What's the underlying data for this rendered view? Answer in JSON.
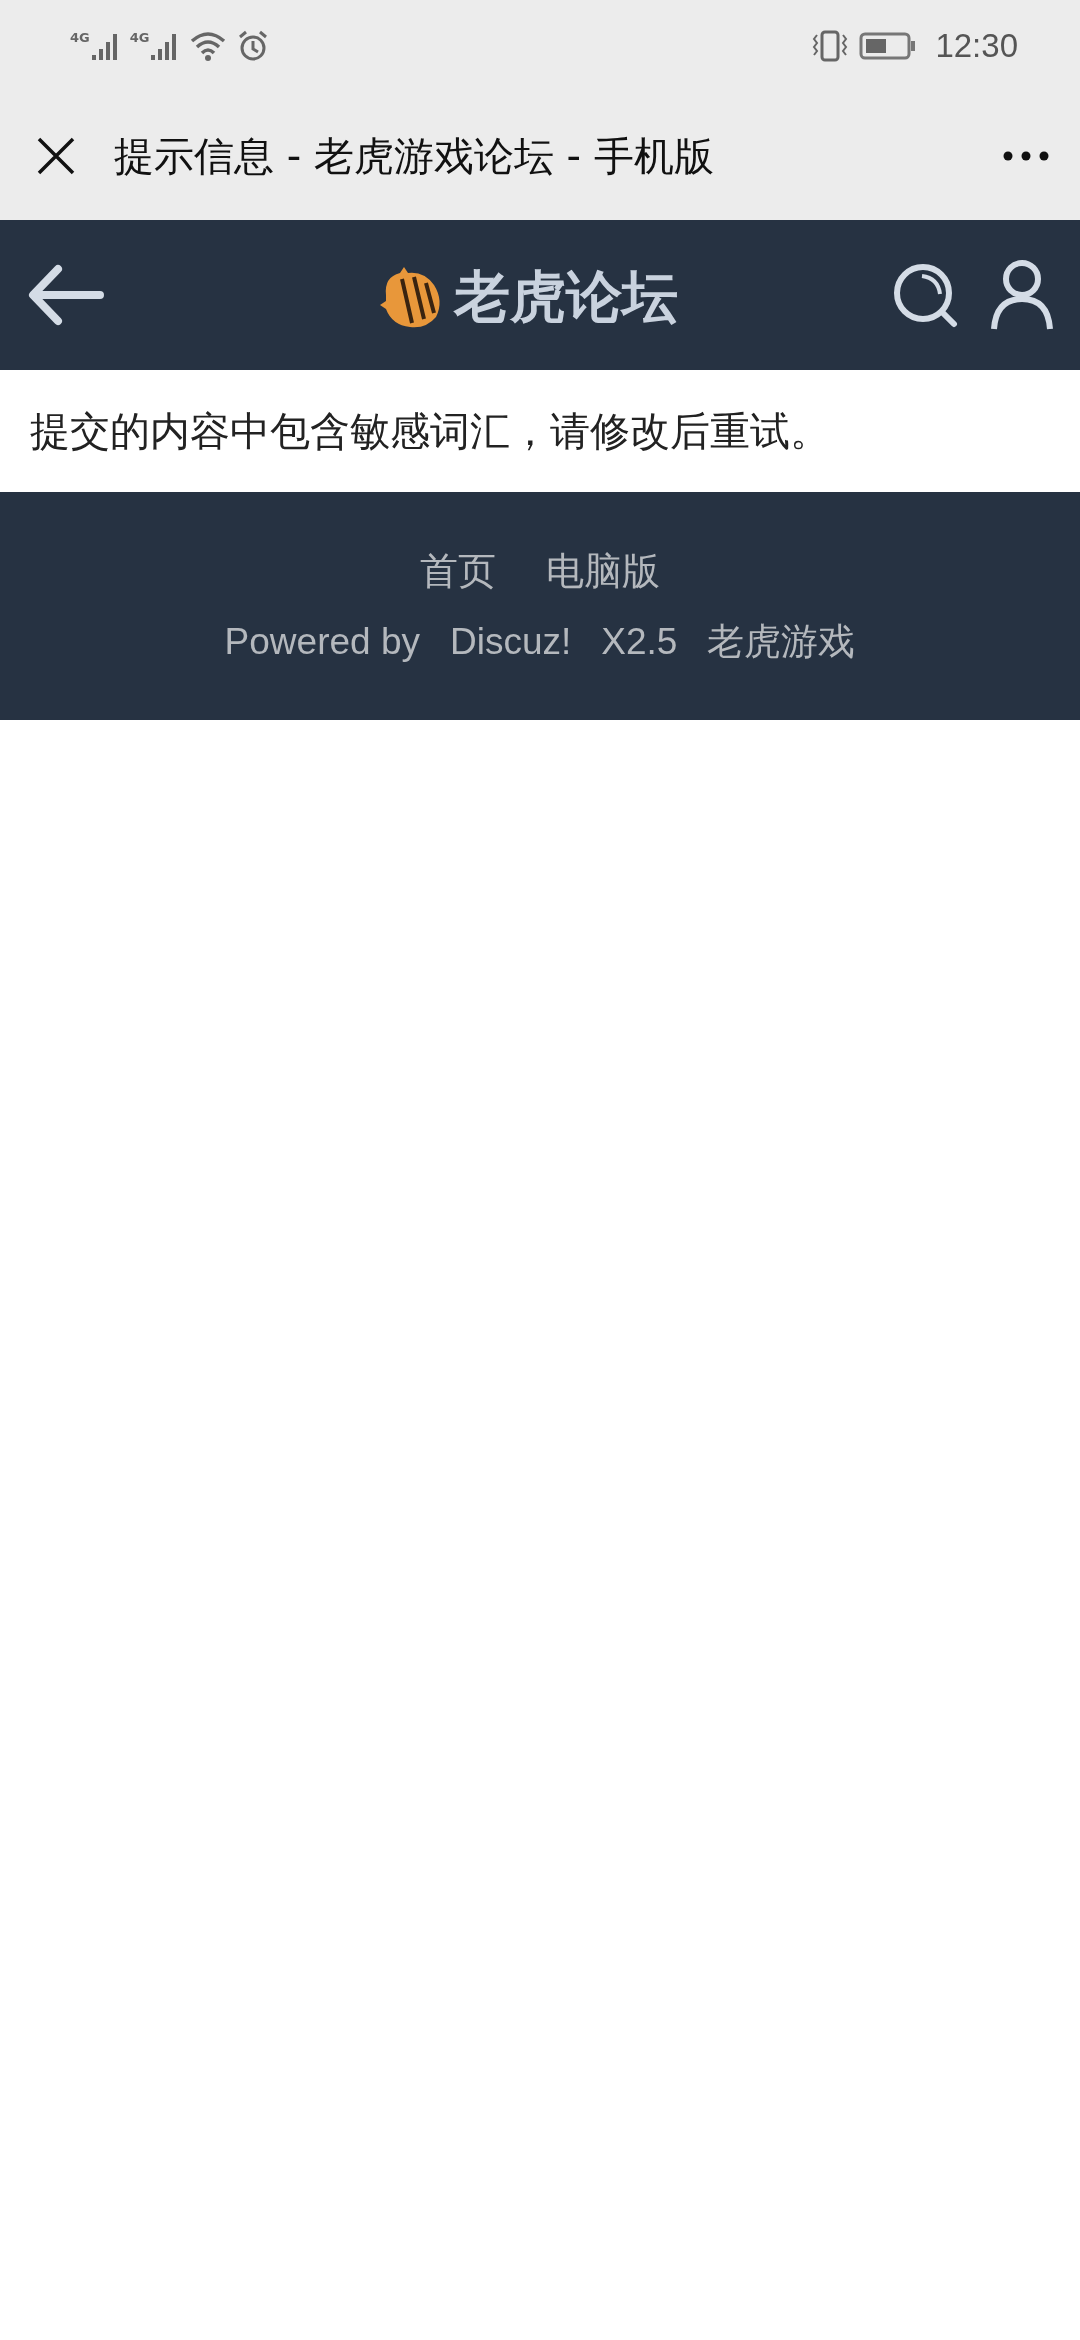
{
  "status_bar": {
    "network": [
      "4G",
      "4G"
    ],
    "time": "12:30"
  },
  "window": {
    "title": "提示信息 - 老虎游戏论坛 - 手机版"
  },
  "nav_bar": {
    "logo_text": "老虎论坛"
  },
  "message": "提交的内容中包含敏感词汇，请修改后重试。",
  "footer": {
    "links": [
      "首页",
      "电脑版"
    ],
    "credits": [
      "Powered by",
      "Discuz!",
      "X2.5",
      "老虎游戏"
    ]
  }
}
